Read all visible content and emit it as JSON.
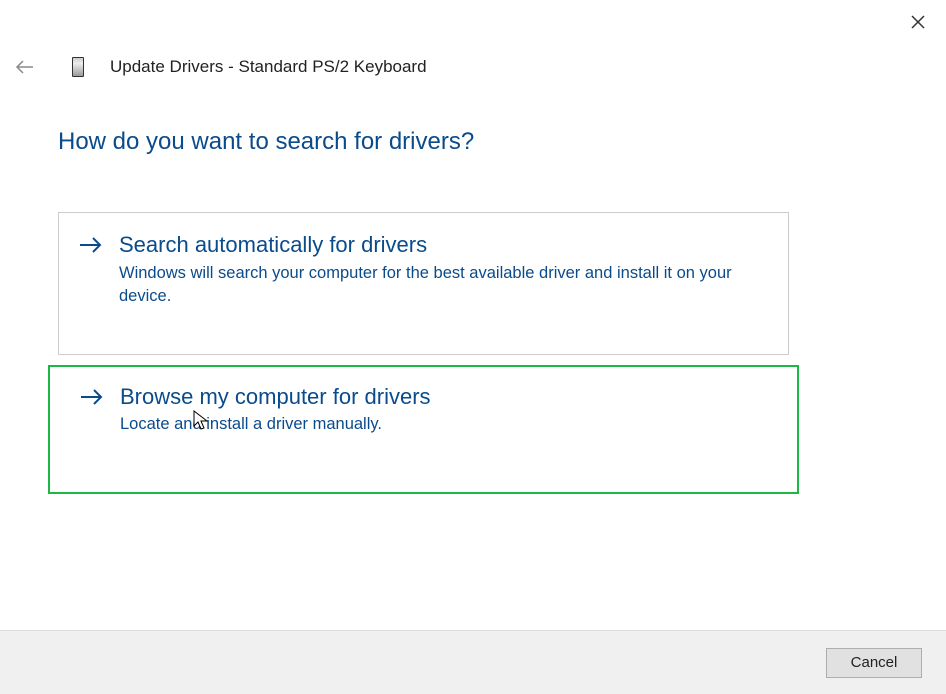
{
  "window": {
    "title": "Update Drivers - Standard PS/2 Keyboard"
  },
  "heading": "How do you want to search for drivers?",
  "options": [
    {
      "title": "Search automatically for drivers",
      "description": "Windows will search your computer for the best available driver and install it on your device."
    },
    {
      "title": "Browse my computer for drivers",
      "description": "Locate and install a driver manually."
    }
  ],
  "footer": {
    "cancel_label": "Cancel"
  }
}
